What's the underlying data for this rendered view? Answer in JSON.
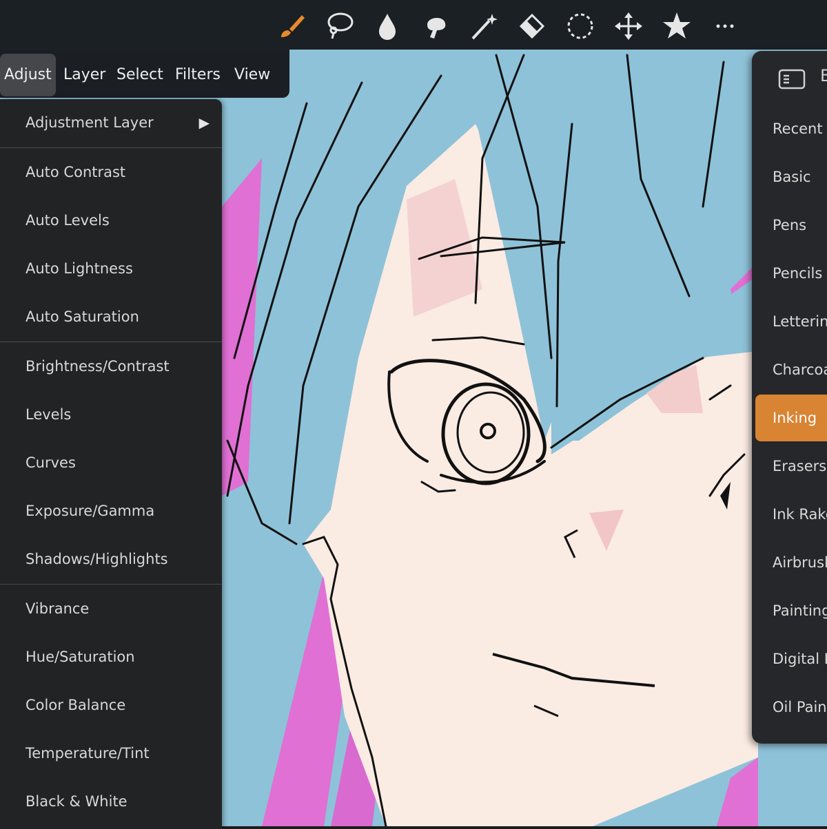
{
  "toolbar": {
    "tools": [
      {
        "name": "paint-brush-icon",
        "color": "#e8892e"
      },
      {
        "name": "lasso-icon"
      },
      {
        "name": "smudge-drop-icon"
      },
      {
        "name": "blur-stamp-icon"
      },
      {
        "name": "magic-wand-icon"
      },
      {
        "name": "eraser-icon"
      },
      {
        "name": "dashed-selection-icon"
      },
      {
        "name": "move-icon"
      },
      {
        "name": "star-icon"
      },
      {
        "name": "more-icon"
      }
    ]
  },
  "menubar": {
    "items": [
      {
        "label": "Adjust",
        "active": true
      },
      {
        "label": "Layer"
      },
      {
        "label": "Select"
      },
      {
        "label": "Filters"
      },
      {
        "label": "View"
      }
    ]
  },
  "adjust_menu": {
    "items": [
      {
        "label": "Adjustment Layer",
        "submenu_arrow": "▶"
      },
      {
        "label": "Auto Contrast"
      },
      {
        "label": "Auto Levels"
      },
      {
        "label": "Auto Lightness"
      },
      {
        "label": "Auto Saturation"
      },
      {
        "label": "Brightness/Contrast"
      },
      {
        "label": "Levels"
      },
      {
        "label": "Curves"
      },
      {
        "label": "Exposure/Gamma"
      },
      {
        "label": "Shadows/Highlights"
      },
      {
        "label": "Vibrance"
      },
      {
        "label": "Hue/Saturation"
      },
      {
        "label": "Color Balance"
      },
      {
        "label": "Temperature/Tint"
      },
      {
        "label": "Black & White"
      }
    ]
  },
  "brush_panel": {
    "title": "B",
    "selected": "Inking",
    "accent_color": "#d88433",
    "categories": [
      "Recent",
      "Basic",
      "Pens",
      "Pencils",
      "Letterin",
      "Charcoa",
      "Inking",
      "Erasers",
      "Ink Rake",
      "Airbrusl",
      "Painting",
      "Digital I",
      "Oil Pain"
    ]
  }
}
